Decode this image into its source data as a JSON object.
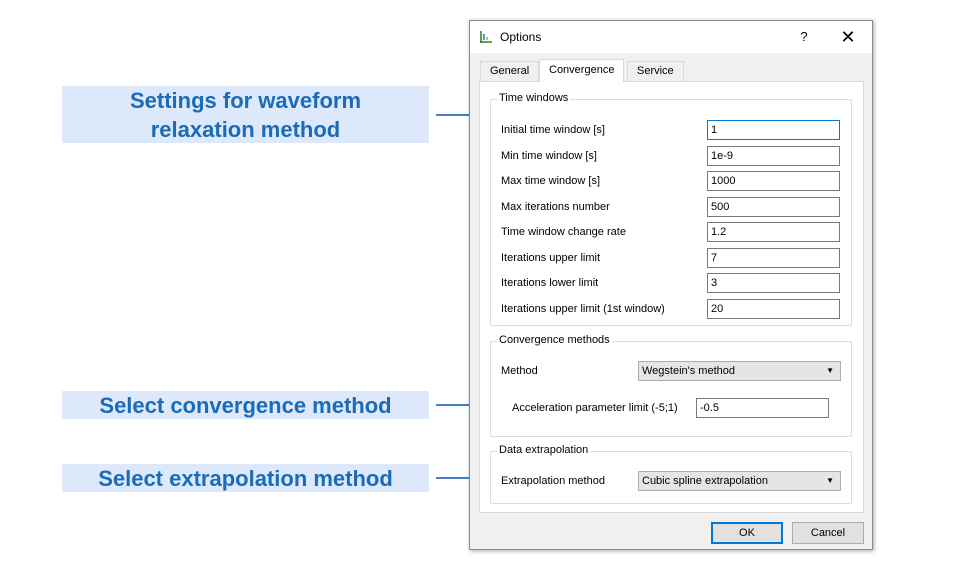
{
  "callouts": {
    "waveform_line1": "Settings for waveform",
    "waveform_line2": "relaxation method",
    "convergence": "Select convergence method",
    "extrapolation": "Select extrapolation method"
  },
  "colors": {
    "callout_bg": "#dde9fb",
    "callout_text": "#1a6bb8",
    "arrow": "#4a80c2",
    "focus_border": "#0078d7"
  },
  "dialog": {
    "title": "Options",
    "app_icon": "chart-icon",
    "help": "?",
    "close": "✕",
    "tabs": [
      "General",
      "Convergence",
      "Service"
    ],
    "active_tab": "Convergence",
    "time_windows": {
      "legend": "Time windows",
      "rows": [
        {
          "label": "Initial time window [s]",
          "value": "1"
        },
        {
          "label": "Min time window [s]",
          "value": "1e-9"
        },
        {
          "label": "Max time window [s]",
          "value": "1000"
        },
        {
          "label": "Max iterations number",
          "value": "500"
        },
        {
          "label": "Time window change rate",
          "value": "1.2"
        },
        {
          "label": "Iterations upper limit",
          "value": "7"
        },
        {
          "label": "Iterations lower limit",
          "value": "3"
        },
        {
          "label": "Iterations upper limit (1st window)",
          "value": "20"
        }
      ]
    },
    "convergence_methods": {
      "legend": "Convergence methods",
      "method_label": "Method",
      "method_value": "Wegstein's method",
      "accel_label": "Acceleration parameter limit (-5;1)",
      "accel_value": "-0.5"
    },
    "data_extrapolation": {
      "legend": "Data extrapolation",
      "method_label": "Extrapolation method",
      "method_value": "Cubic spline extrapolation"
    },
    "buttons": {
      "ok": "OK",
      "cancel": "Cancel"
    }
  }
}
